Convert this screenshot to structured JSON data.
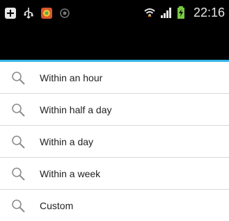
{
  "status_bar": {
    "time": "22:16",
    "icons": [
      "notification-plus-icon",
      "usb-icon",
      "app-icon",
      "recorder-icon",
      "wifi-icon",
      "signal-icon",
      "battery-charging-icon"
    ]
  },
  "list": {
    "items": [
      {
        "label": "Within an hour",
        "icon": "search-icon"
      },
      {
        "label": "Within half a day",
        "icon": "search-icon"
      },
      {
        "label": "Within a day",
        "icon": "search-icon"
      },
      {
        "label": "Within a week",
        "icon": "search-icon"
      },
      {
        "label": "Custom",
        "icon": "search-icon"
      }
    ]
  },
  "colors": {
    "accent": "#33b5e5",
    "status_bar_bg": "#000000",
    "battery_green": "#7ac943"
  }
}
